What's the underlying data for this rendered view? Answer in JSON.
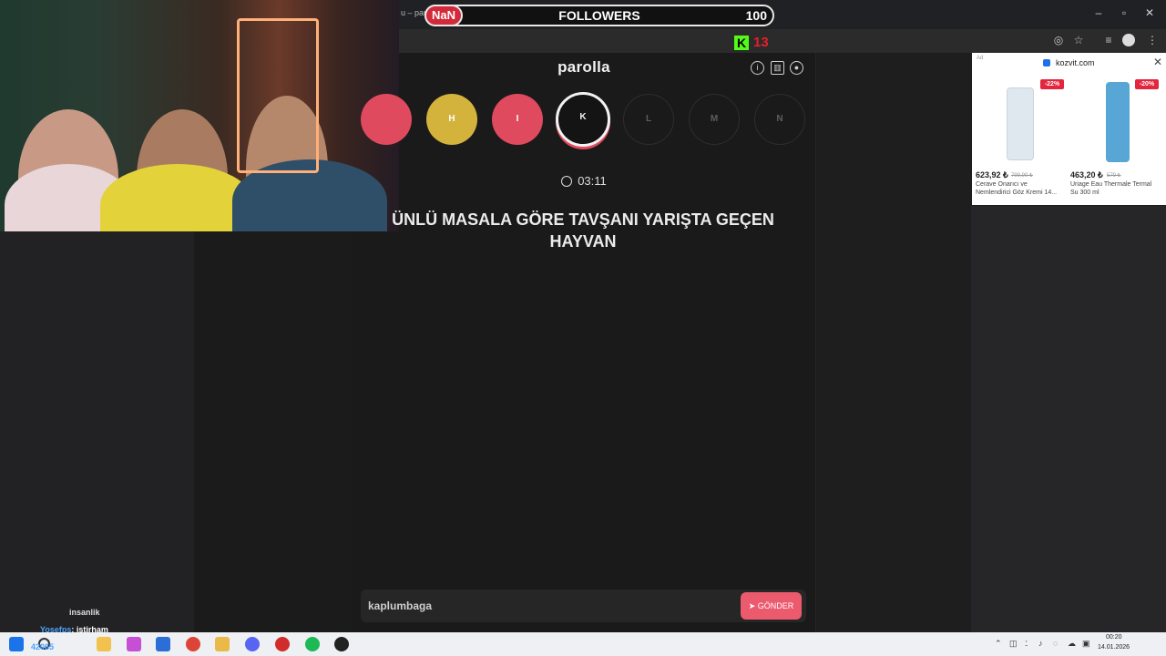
{
  "browser": {
    "tab_text": "u – parol",
    "new_tab": "+",
    "window_controls": {
      "minimize": "–",
      "maximize": "▫",
      "close": "✕"
    }
  },
  "overlay": {
    "badge": "NaN",
    "followers_label": "FOLLOWERS",
    "followers_count": "100",
    "kick_logo": "K",
    "kick_count": "13"
  },
  "app": {
    "title": "parolla",
    "header_icons": [
      "info-icon",
      "stats-icon",
      "profile-icon"
    ],
    "letters": [
      {
        "label": "",
        "state": "red"
      },
      {
        "label": "H",
        "state": "yellow"
      },
      {
        "label": "I",
        "state": "red"
      },
      {
        "label": "K",
        "state": "active"
      },
      {
        "label": "L",
        "state": "empty"
      },
      {
        "label": "M",
        "state": "empty"
      },
      {
        "label": "N",
        "state": "empty"
      }
    ],
    "timer": "03:11",
    "question": "ÜNLÜ MASALA GÖRE TAVŞANI YARIŞTA GEÇEN HAYVAN",
    "answer_value": "kaplumbaga",
    "send_label": "GÖNDER"
  },
  "ad": {
    "mark": "Ad",
    "domain": "kozvit.com",
    "close": "✕",
    "products": [
      {
        "discount": "-22%",
        "price": "623,92 ₺",
        "old_price": "799,90 ₺",
        "name": "Cerave Onarıcı ve Nemlendirici Göz Kremi 14...",
        "color": "#dfe7ef"
      },
      {
        "discount": "-20%",
        "price": "463,20 ₺",
        "old_price": "579 ₺",
        "name": "Uriage Eau Thermale Termal Su 300 ml",
        "color": "#58a6d6"
      }
    ]
  },
  "chat": [
    {
      "user": "insanlik",
      "message": ""
    },
    {
      "user": "Yosefps",
      "message": ": istirham"
    },
    {
      "user": "42065",
      "message": ""
    }
  ],
  "taskbar": {
    "time": "00:20",
    "date": "14.01.2026",
    "apps": [
      {
        "name": "windows-start-icon",
        "color": "#1a73e8"
      },
      {
        "name": "search-icon",
        "color": "#333333"
      },
      {
        "name": "file-explorer-icon",
        "color": "#f2c14e"
      },
      {
        "name": "copilot-icon",
        "color": "#c64fd6"
      },
      {
        "name": "store-icon",
        "color": "#2b6fd6"
      },
      {
        "name": "chrome-icon",
        "color": "#db4437"
      },
      {
        "name": "folder-icon",
        "color": "#e9b949"
      },
      {
        "name": "discord-icon",
        "color": "#5865f2"
      },
      {
        "name": "app-red-icon",
        "color": "#d12c2c"
      },
      {
        "name": "spotify-icon",
        "color": "#1db954"
      },
      {
        "name": "app-dark-icon",
        "color": "#222222"
      }
    ]
  }
}
